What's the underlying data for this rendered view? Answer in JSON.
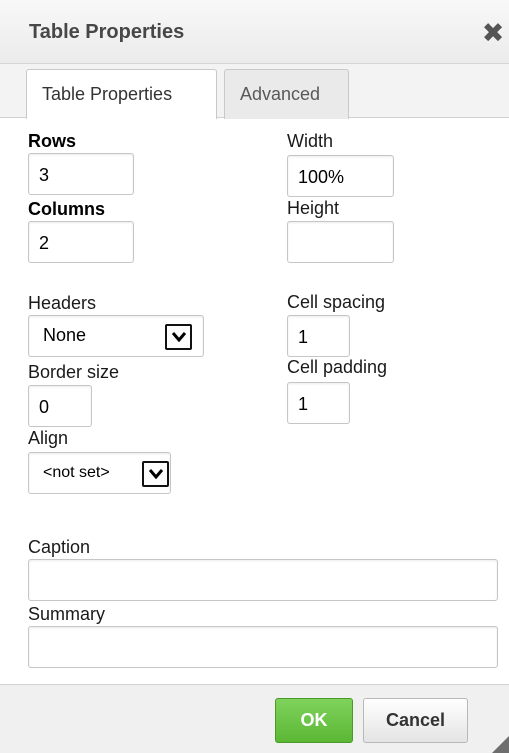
{
  "dialog": {
    "title": "Table Properties",
    "close_glyph": "✖"
  },
  "tabs": [
    {
      "label": "Table Properties",
      "active": true
    },
    {
      "label": "Advanced",
      "active": false
    }
  ],
  "form": {
    "rows": {
      "label": "Rows",
      "value": "3"
    },
    "columns": {
      "label": "Columns",
      "value": "2"
    },
    "width": {
      "label": "Width",
      "value": "100%"
    },
    "height": {
      "label": "Height",
      "value": ""
    },
    "headers": {
      "label": "Headers",
      "selected": "None"
    },
    "cell_spacing": {
      "label": "Cell spacing",
      "value": "1"
    },
    "border_size": {
      "label": "Border size",
      "value": "0"
    },
    "cell_padding": {
      "label": "Cell padding",
      "value": "1"
    },
    "align": {
      "label": "Align",
      "selected": "<not set>"
    },
    "caption": {
      "label": "Caption",
      "value": ""
    },
    "summary": {
      "label": "Summary",
      "value": ""
    }
  },
  "footer": {
    "ok_label": "OK",
    "cancel_label": "Cancel"
  },
  "colors": {
    "ok_button": "#5cb735",
    "title_text": "#474747"
  },
  "icons": {
    "close": "close-icon",
    "dropdown": "chevron-down-icon",
    "resize": "resize-grip-icon"
  }
}
